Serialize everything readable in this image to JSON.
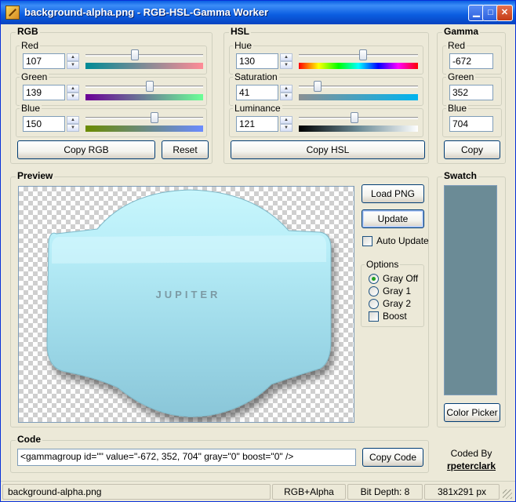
{
  "window": {
    "title": "background-alpha.png - RGB-HSL-Gamma Worker"
  },
  "rgb": {
    "title": "RGB",
    "red": {
      "label": "Red",
      "value": "107",
      "level": 0.42
    },
    "green": {
      "label": "Green",
      "value": "139",
      "level": 0.545
    },
    "blue": {
      "label": "Blue",
      "value": "150",
      "level": 0.588
    },
    "copy_label": "Copy RGB",
    "reset_label": "Reset"
  },
  "hsl": {
    "title": "HSL",
    "hue": {
      "label": "Hue",
      "value": "130",
      "level": 0.54
    },
    "saturation": {
      "label": "Saturation",
      "value": "41",
      "level": 0.16
    },
    "luminance": {
      "label": "Luminance",
      "value": "121",
      "level": 0.47
    },
    "copy_label": "Copy HSL"
  },
  "gamma": {
    "title": "Gamma",
    "red": {
      "label": "Red",
      "value": "-672"
    },
    "green": {
      "label": "Green",
      "value": "352"
    },
    "blue": {
      "label": "Blue",
      "value": "704"
    },
    "copy_label": "Copy"
  },
  "preview": {
    "title": "Preview",
    "logo_text": "JUPITER",
    "load_label": "Load PNG",
    "update_label": "Update",
    "auto_update_label": "Auto Update",
    "auto_update_checked": false,
    "options": {
      "title": "Options",
      "items": [
        {
          "label": "Gray Off",
          "selected": true
        },
        {
          "label": "Gray 1",
          "selected": false
        },
        {
          "label": "Gray 2",
          "selected": false
        }
      ],
      "boost_label": "Boost",
      "boost_checked": false
    }
  },
  "swatch": {
    "title": "Swatch",
    "color": "#6b8b96",
    "picker_label": "Color Picker"
  },
  "code": {
    "title": "Code",
    "value": "<gammagroup id=\"\" value=\"-672, 352, 704\" gray=\"0\" boost=\"0\" />",
    "copy_label": "Copy Code"
  },
  "credits": {
    "coded_by": "Coded By",
    "author": "rpeterclark"
  },
  "status": {
    "filename": "background-alpha.png",
    "mode": "RGB+Alpha",
    "bit_depth": "Bit Depth: 8",
    "size": "381x291 px"
  },
  "colors": {
    "titlebar": "#0a5fe3",
    "image_main": "#aee9f5",
    "swatch": "#6b8b96"
  }
}
